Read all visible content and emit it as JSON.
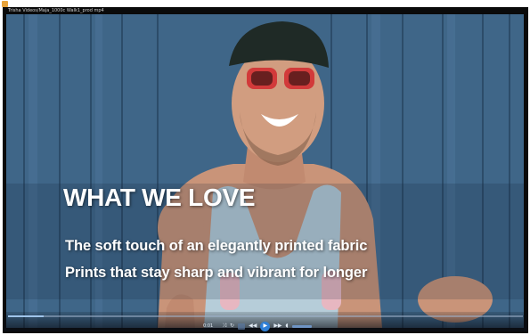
{
  "window": {
    "title": "Trisha Videos/Maja_1000c Walk1_prod mp4",
    "icon": "app-icon"
  },
  "video": {
    "overlay_heading": "WHAT WE LOVE",
    "overlay_lines": [
      "The soft touch of an elegantly printed fabric",
      "Prints that stay sharp and vibrant for longer"
    ]
  },
  "player": {
    "progress": 0.07,
    "time": "0:01",
    "controls": [
      {
        "icon": "shuffle-icon",
        "glyph": "⤨"
      },
      {
        "icon": "repeat-icon",
        "glyph": "↻"
      },
      {
        "icon": "stop-icon",
        "glyph": "■"
      },
      {
        "icon": "previous-icon",
        "glyph": "◀◀"
      },
      {
        "icon": "play-icon",
        "glyph": "▶"
      },
      {
        "icon": "next-icon",
        "glyph": "▶▶"
      },
      {
        "icon": "mute-icon",
        "glyph": "🔈"
      }
    ],
    "accent_color": "#2f7fd6"
  }
}
